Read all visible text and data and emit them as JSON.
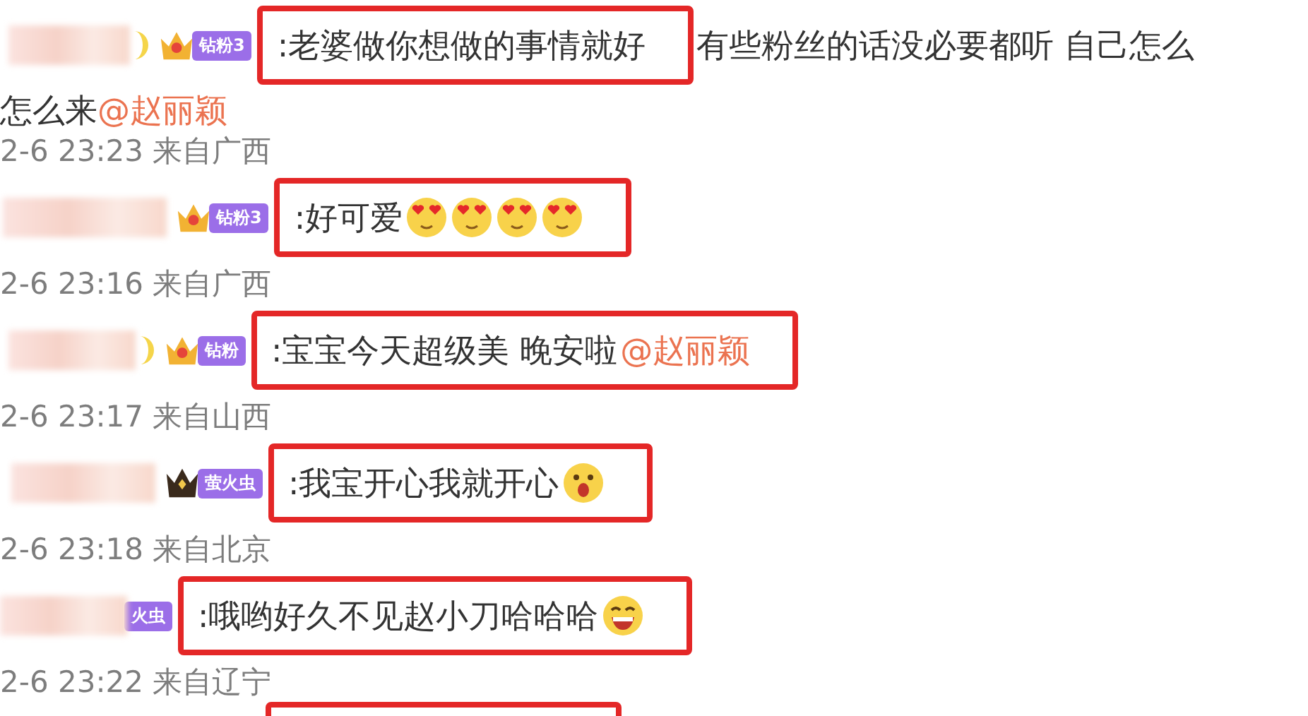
{
  "comments": [
    {
      "moon": true,
      "crown": {
        "kind": "gold"
      },
      "badge": "钻粉3",
      "highlight": ":老婆做你想做的事情就好",
      "rest": " 有些粉丝的话没必要都听 自己怎么",
      "continuation": "怎么来",
      "mention": "@赵丽颖",
      "time": "2-6 23:23 来自广西"
    },
    {
      "moon": false,
      "crown": {
        "kind": "gold"
      },
      "badge": "钻粉3",
      "highlight": ":好可爱",
      "emojis": [
        {
          "kind": "heart-eyes"
        },
        {
          "kind": "heart-eyes"
        },
        {
          "kind": "heart-eyes"
        },
        {
          "kind": "heart-eyes"
        }
      ],
      "time": "2-6 23:16 来自广西"
    },
    {
      "moon": true,
      "crown": {
        "kind": "gold"
      },
      "badge": "钻粉",
      "highlight": ":宝宝今天超级美 晚安啦",
      "box_mention": "@赵丽颖",
      "time": "2-6 23:17 来自山西"
    },
    {
      "moon": false,
      "crown": {
        "kind": "black"
      },
      "badge": "萤火虫",
      "highlight": ":我宝开心我就开心",
      "emojis": [
        {
          "kind": "surprised"
        }
      ],
      "time": "2-6 23:18 来自北京"
    },
    {
      "moon": false,
      "badge": "火虫",
      "highlight": ":哦哟好久不见赵小刀哈哈哈",
      "emojis": [
        {
          "kind": "laughing"
        }
      ],
      "time": "2-6 23:22 来自辽宁"
    }
  ],
  "trailing_highlight": true
}
